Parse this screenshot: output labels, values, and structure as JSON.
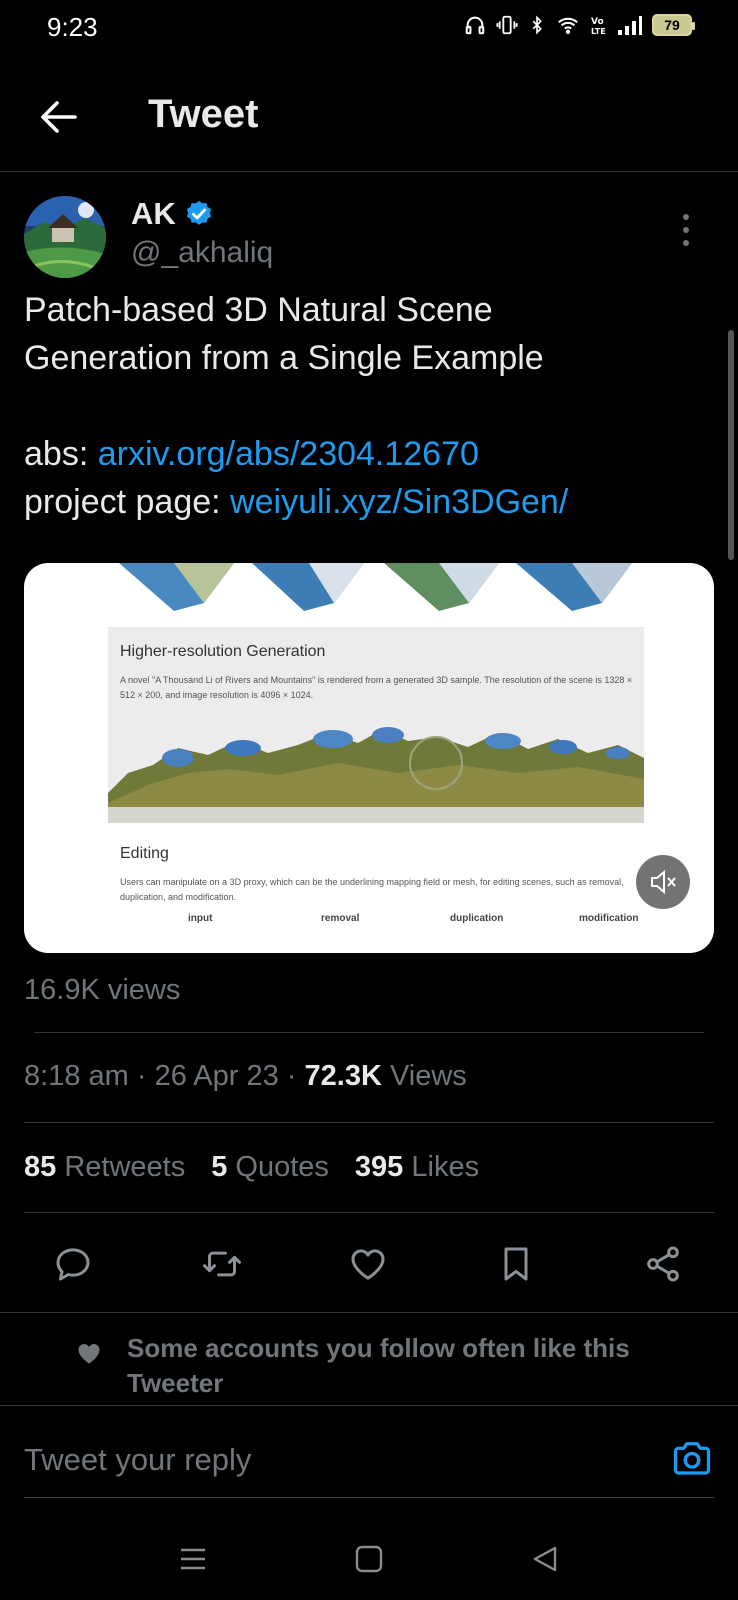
{
  "status_bar": {
    "time": "9:23",
    "battery": "79"
  },
  "header": {
    "title": "Tweet"
  },
  "tweet": {
    "author_name": "AK",
    "author_handle": "@_akhaliq",
    "text_line1": "Patch-based 3D Natural Scene",
    "text_line2": "Generation from a Single Example",
    "abs_label": "abs:",
    "abs_link": "arxiv.org/abs/2304.12670",
    "project_label": "project page:",
    "project_link": "weiyuli.xyz/Sin3DGen/"
  },
  "media": {
    "panel_title": "Higher-resolution Generation",
    "panel_desc": "A novel \"A Thousand Li of Rivers and Mountains\" is rendered from a generated 3D sample. The resolution of the scene is 1328 × 512 × 200, and image resolution is 4096 × 1024.",
    "editing_title": "Editing",
    "editing_desc": "Users can manipulate on a 3D proxy, which can be the underlining mapping field or mesh, for editing scenes, such as removal, duplication, and modification.",
    "labels": [
      "input",
      "removal",
      "duplication",
      "modification"
    ]
  },
  "stats": {
    "video_views": "16.9K views",
    "time": "8:18 am",
    "date": "26 Apr 23",
    "views_count": "72.3K",
    "views_label": "Views",
    "retweets_count": "85",
    "retweets_label": "Retweets",
    "quotes_count": "5",
    "quotes_label": "Quotes",
    "likes_count": "395",
    "likes_label": "Likes"
  },
  "social_context": {
    "text": "Some accounts you follow often like this Tweeter"
  },
  "reply": {
    "placeholder": "Tweet your reply"
  },
  "colors": {
    "accent": "#1d9bf0",
    "background": "#000000",
    "muted": "#71767b",
    "text": "#e7e9ea"
  }
}
